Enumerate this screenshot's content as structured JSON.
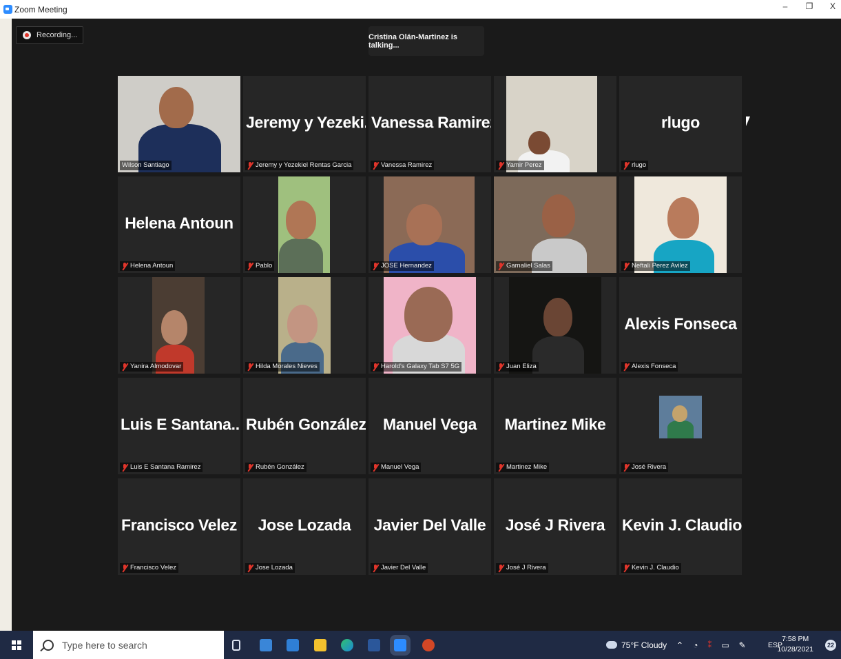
{
  "window": {
    "title": "Zoom Meeting",
    "minimize": "–",
    "restore": "❐",
    "close": "X"
  },
  "recording": {
    "label": "Recording..."
  },
  "talking_indicator": "Cristina Olán-Martinez is talking...",
  "participants": [
    {
      "big_name": "",
      "label": "Wilson Santiago",
      "muted": false,
      "video": true
    },
    {
      "big_name": "Jeremy y Yezeki...",
      "label": "Jeremy y Yezekiel Rentas Garcia",
      "muted": true,
      "video": false
    },
    {
      "big_name": "Vanessa Ramirez",
      "label": "Vanessa Ramirez",
      "muted": true,
      "video": false
    },
    {
      "big_name": "",
      "label": "Yamir Perez",
      "muted": true,
      "video": true
    },
    {
      "big_name": "rlugo",
      "label": "rlugo",
      "muted": true,
      "video": false
    },
    {
      "big_name": "Helena Antoun",
      "label": "Helena Antoun",
      "muted": true,
      "video": false
    },
    {
      "big_name": "",
      "label": "Pablo",
      "muted": true,
      "video": true
    },
    {
      "big_name": "",
      "label": "JOSE Hernandez",
      "muted": true,
      "video": true
    },
    {
      "big_name": "",
      "label": "Gamaliel Salas",
      "muted": true,
      "video": true
    },
    {
      "big_name": "",
      "label": "Neftali Perez Avilez",
      "muted": true,
      "video": true
    },
    {
      "big_name": "",
      "label": "Yanira Almodovar",
      "muted": true,
      "video": true
    },
    {
      "big_name": "",
      "label": "Hilda Morales Nieves",
      "muted": true,
      "video": true
    },
    {
      "big_name": "",
      "label": "Harold's Galaxy Tab S7 5G",
      "muted": true,
      "video": true
    },
    {
      "big_name": "",
      "label": "Juan Eliza",
      "muted": true,
      "video": true
    },
    {
      "big_name": "Alexis Fonseca",
      "label": "Alexis Fonseca",
      "muted": true,
      "video": false
    },
    {
      "big_name": "Luis E Santana...",
      "label": "Luis E Santana Ramirez",
      "muted": true,
      "video": false
    },
    {
      "big_name": "Rubén González",
      "label": "Rubén González",
      "muted": true,
      "video": false
    },
    {
      "big_name": "Manuel Vega",
      "label": "Manuel Vega",
      "muted": true,
      "video": false
    },
    {
      "big_name": "Martinez Mike",
      "label": "Martinez Mike",
      "muted": true,
      "video": false
    },
    {
      "big_name": "",
      "label": "José Rivera",
      "muted": true,
      "video": true
    },
    {
      "big_name": "Francisco Velez",
      "label": "Francisco Velez",
      "muted": true,
      "video": false
    },
    {
      "big_name": "Jose Lozada",
      "label": "Jose Lozada",
      "muted": true,
      "video": false
    },
    {
      "big_name": "Javier Del Valle",
      "label": "Javier Del Valle",
      "muted": true,
      "video": false
    },
    {
      "big_name": "José J Rivera",
      "label": "José J Rivera",
      "muted": true,
      "video": false
    },
    {
      "big_name": "Kevin J. Claudio",
      "label": "Kevin J. Claudio",
      "muted": true,
      "video": false
    }
  ],
  "taskbar": {
    "search_placeholder": "Type here to search",
    "weather": "75°F  Cloudy",
    "language": "ESP",
    "time": "7:58 PM",
    "date": "10/28/2021",
    "notification_count": "22"
  },
  "colors": {
    "accent": "#2d8cff",
    "muted_mic": "#e0352b",
    "taskbar": "#1f2a44",
    "meeting_bg": "#1a1a1a",
    "tile_bg": "#262626"
  }
}
